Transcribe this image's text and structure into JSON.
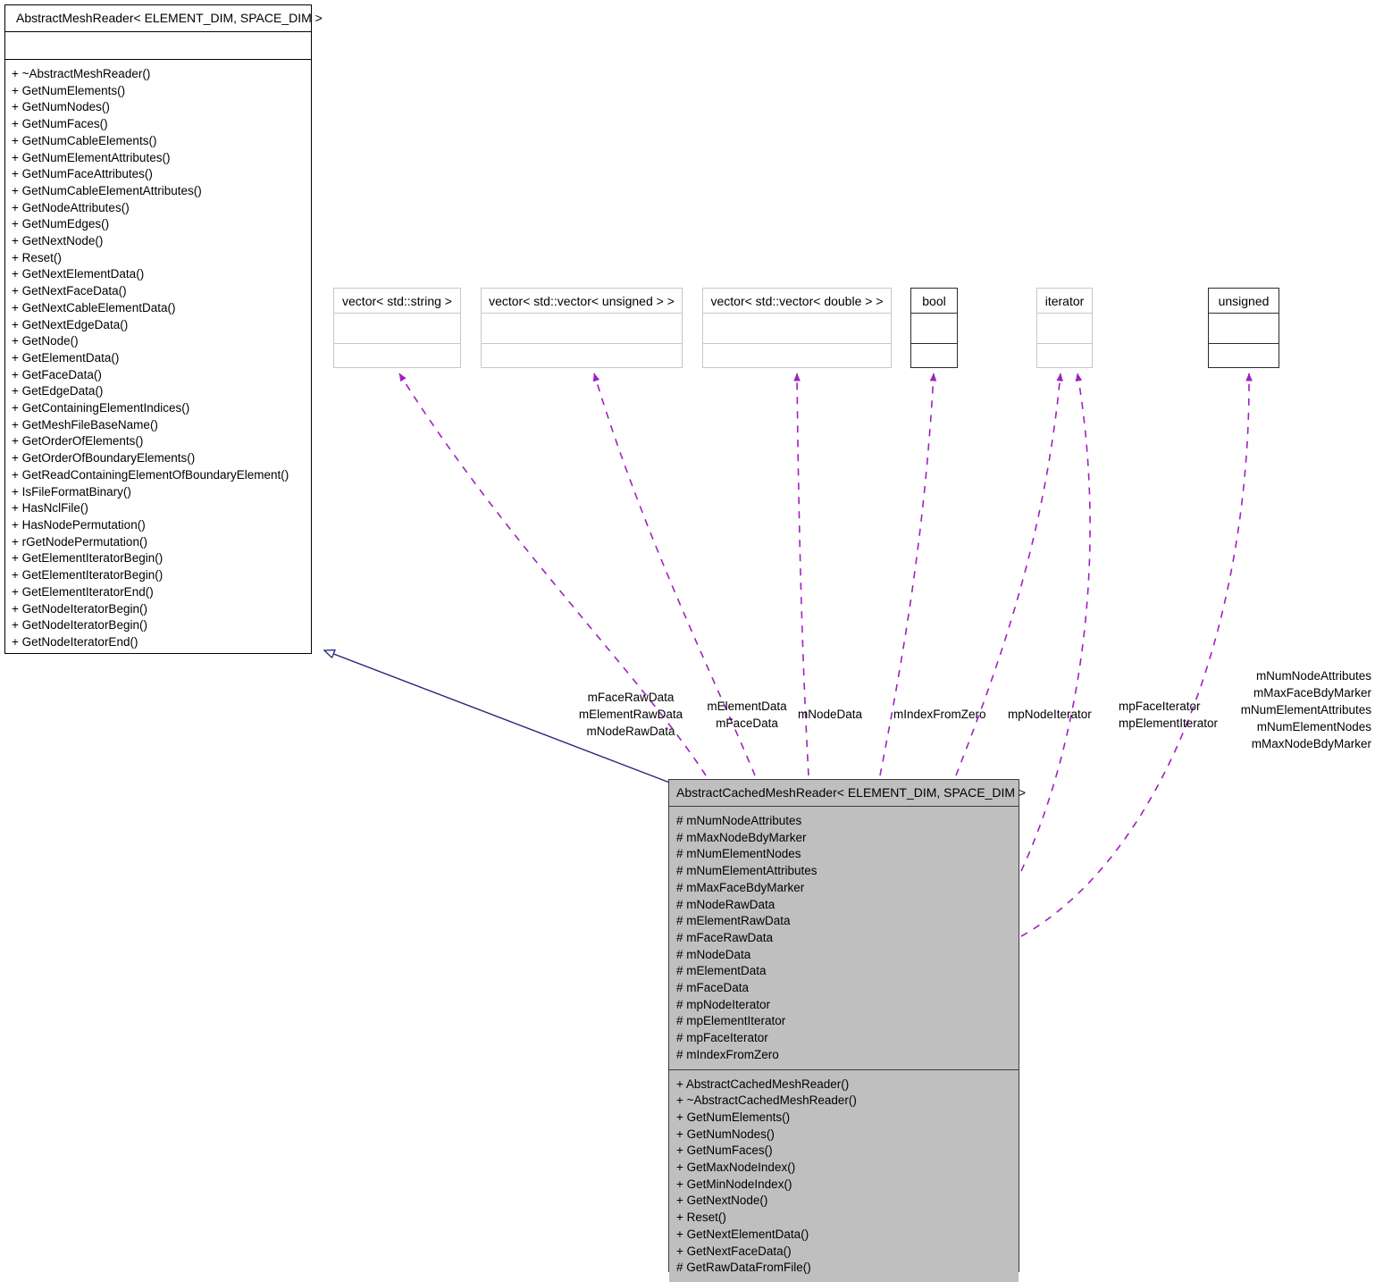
{
  "diagram": {
    "title": "AbstractCachedMeshReader collaboration diagram",
    "colors": {
      "inheritance_edge": "#26267a",
      "usage_edge": "#a020c0",
      "derived_fill": "#bfbfbf",
      "type_box_border_light": "#c8c8c8",
      "type_box_border_dark": "#2b2b2b",
      "background": "#ffffff"
    }
  },
  "base_class": {
    "name": "AbstractMeshReader< ELEMENT_DIM, SPACE_DIM >",
    "attributes": [],
    "methods": [
      "+ ~AbstractMeshReader()",
      "+ GetNumElements()",
      "+ GetNumNodes()",
      "+ GetNumFaces()",
      "+ GetNumCableElements()",
      "+ GetNumElementAttributes()",
      "+ GetNumFaceAttributes()",
      "+ GetNumCableElementAttributes()",
      "+ GetNodeAttributes()",
      "+ GetNumEdges()",
      "+ GetNextNode()",
      "+ Reset()",
      "+ GetNextElementData()",
      "+ GetNextFaceData()",
      "+ GetNextCableElementData()",
      "+ GetNextEdgeData()",
      "+ GetNode()",
      "+ GetElementData()",
      "+ GetFaceData()",
      "+ GetEdgeData()",
      "+ GetContainingElementIndices()",
      "+ GetMeshFileBaseName()",
      "+ GetOrderOfElements()",
      "+ GetOrderOfBoundaryElements()",
      "+ GetReadContainingElementOfBoundaryElement()",
      "+ IsFileFormatBinary()",
      "+ HasNclFile()",
      "+ HasNodePermutation()",
      "+ rGetNodePermutation()",
      "+ GetElementIteratorBegin()",
      "+ GetElementIteratorBegin()",
      "+ GetElementIteratorEnd()",
      "+ GetNodeIteratorBegin()",
      "+ GetNodeIteratorBegin()",
      "+ GetNodeIteratorEnd()"
    ]
  },
  "type_boxes": [
    {
      "id": "vector-string",
      "name": "vector< std::string >"
    },
    {
      "id": "vector-unsigned",
      "name": "vector< std::vector< unsigned > >"
    },
    {
      "id": "vector-double",
      "name": "vector< std::vector< double > >"
    },
    {
      "id": "bool",
      "name": "bool"
    },
    {
      "id": "iterator",
      "name": "iterator"
    },
    {
      "id": "unsigned",
      "name": "unsigned"
    }
  ],
  "derived_class": {
    "name": "AbstractCachedMeshReader< ELEMENT_DIM, SPACE_DIM >",
    "attributes": [
      "# mNumNodeAttributes",
      "# mMaxNodeBdyMarker",
      "# mNumElementNodes",
      "# mNumElementAttributes",
      "# mMaxFaceBdyMarker",
      "# mNodeRawData",
      "# mElementRawData",
      "# mFaceRawData",
      "# mNodeData",
      "# mElementData",
      "# mFaceData",
      "# mpNodeIterator",
      "# mpElementIterator",
      "# mpFaceIterator",
      "# mIndexFromZero"
    ],
    "methods": [
      "+ AbstractCachedMeshReader()",
      "+ ~AbstractCachedMeshReader()",
      "+ GetNumElements()",
      "+ GetNumNodes()",
      "+ GetNumFaces()",
      "+ GetMaxNodeIndex()",
      "+ GetMinNodeIndex()",
      "+ GetNextNode()",
      "+ Reset()",
      "+ GetNextElementData()",
      "+ GetNextFaceData()",
      "# GetRawDataFromFile()"
    ]
  },
  "edge_labels": {
    "rawdata": [
      "mFaceRawData",
      "mElementRawData",
      "mNodeRawData"
    ],
    "elemface": [
      "mElementData",
      "mFaceData"
    ],
    "nodedata": [
      "mNodeData"
    ],
    "indexzero": [
      "mIndexFromZero"
    ],
    "nodeiter": [
      "mpNodeIterator"
    ],
    "faceelem": [
      "mpFaceIterator",
      "mpElementIterator"
    ],
    "unsignedset": [
      "mNumNodeAttributes",
      "mMaxFaceBdyMarker",
      "mNumElementAttributes",
      "mNumElementNodes",
      "mMaxNodeBdyMarker"
    ]
  }
}
